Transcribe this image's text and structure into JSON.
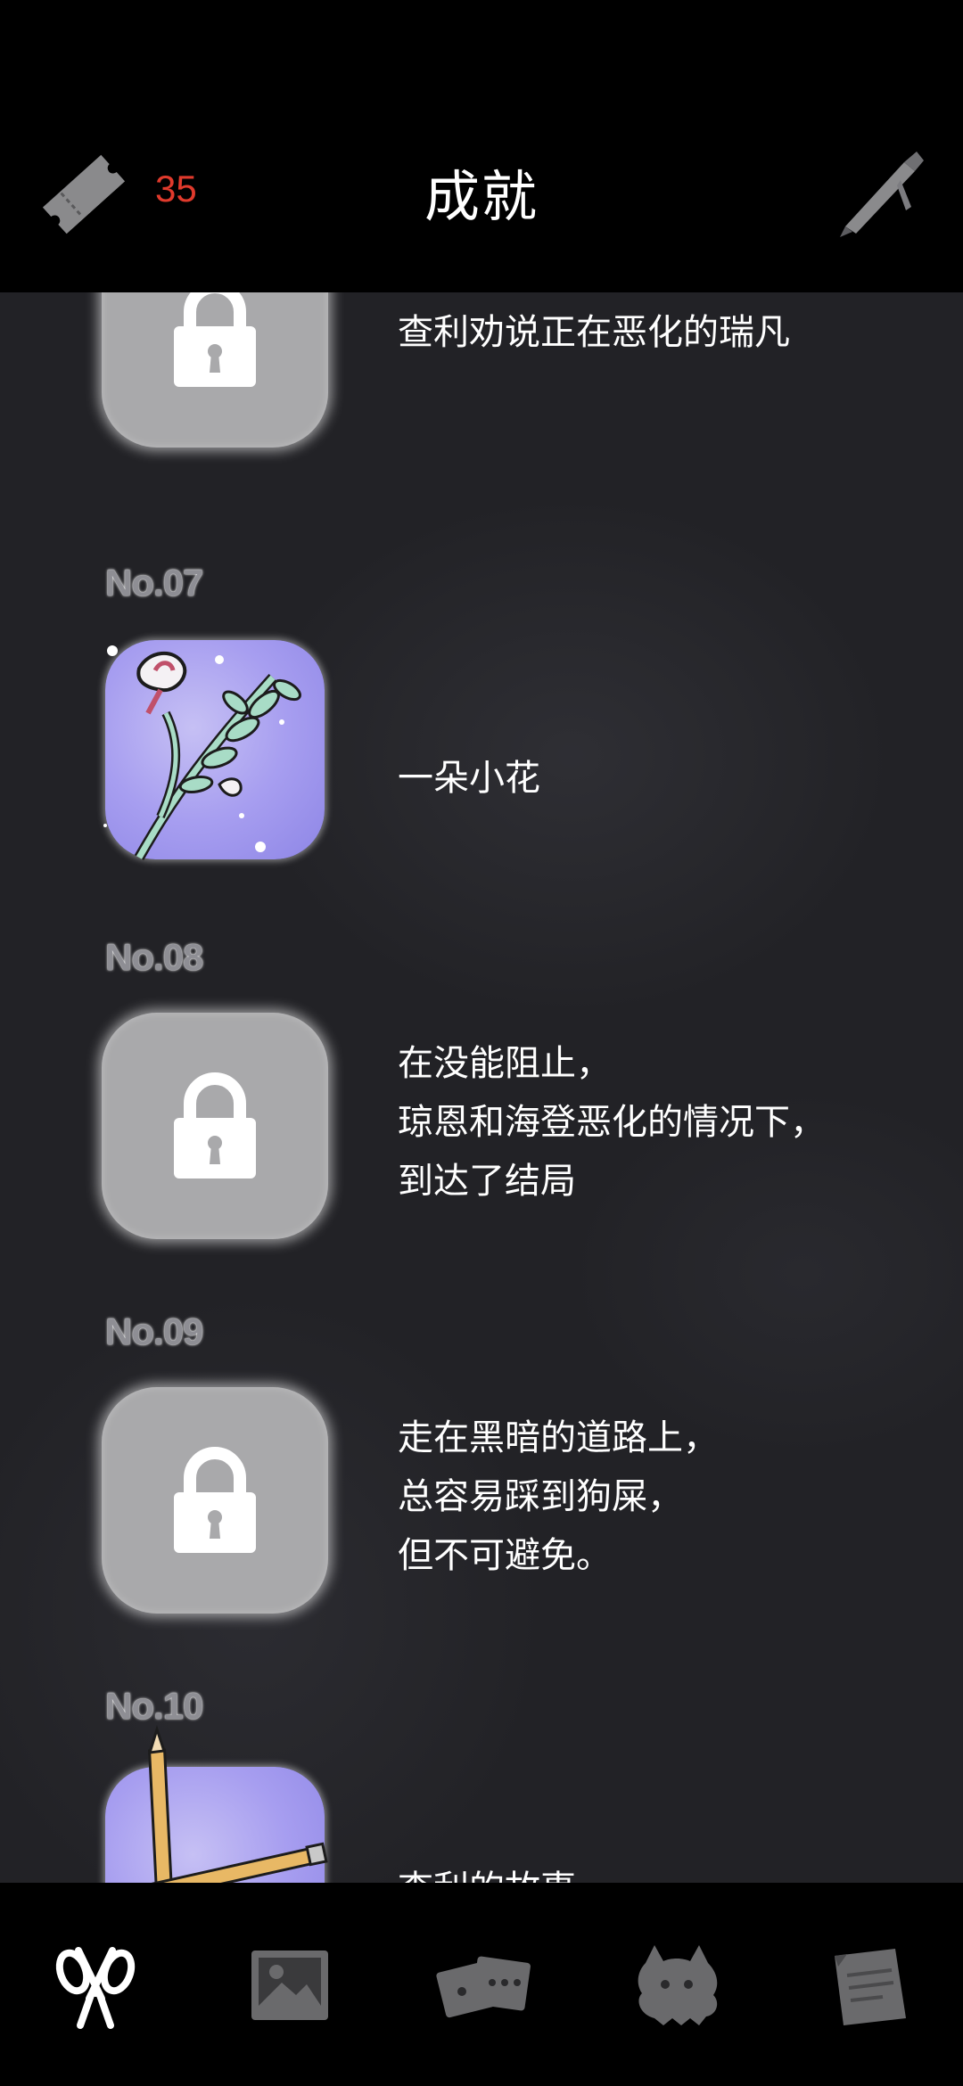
{
  "header": {
    "ticket_count": "35",
    "title": "成就",
    "icons": {
      "left": "ticket-icon",
      "right": "pen-icon"
    },
    "ticket_count_color": "#e03a2c"
  },
  "achievements": [
    {
      "number": "",
      "locked": true,
      "description": "查利劝说正在恶化的瑞凡",
      "icon": "lock-icon"
    },
    {
      "number": "No.07",
      "locked": false,
      "description": "一朵小花",
      "icon": "flower-icon"
    },
    {
      "number": "No.08",
      "locked": true,
      "description": "在没能阻止，\n琼恩和海登恶化的情况下，\n到达了结局",
      "icon": "lock-icon"
    },
    {
      "number": "No.09",
      "locked": true,
      "description": "走在黑暗的道路上，\n总容易踩到狗屎，\n但不可避免。",
      "icon": "lock-icon"
    },
    {
      "number": "No.10",
      "locked": false,
      "description": "查利的故事",
      "icon": "pencils-icon"
    }
  ],
  "bottom_nav": {
    "items": [
      {
        "icon": "scissors-icon",
        "active": true
      },
      {
        "icon": "photo-icon",
        "active": false
      },
      {
        "icon": "cards-icon",
        "active": false
      },
      {
        "icon": "monster-icon",
        "active": false
      },
      {
        "icon": "document-icon",
        "active": false
      }
    ]
  },
  "colors": {
    "background": "#222226",
    "bar": "#000000",
    "locked_icon": "#a9a9ab",
    "unlocked_icon": "#a79ef0"
  }
}
